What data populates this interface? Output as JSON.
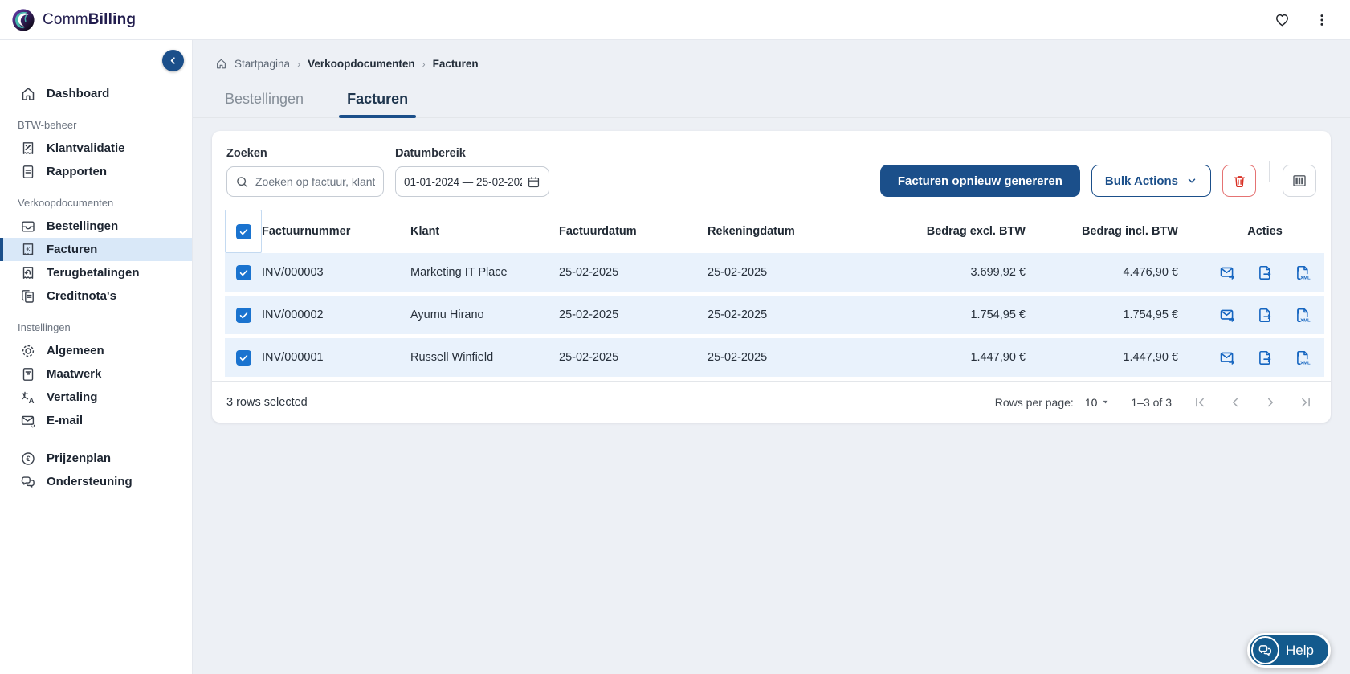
{
  "brand": {
    "prefix": "Comm",
    "suffix": "Billing"
  },
  "sidebar": {
    "items": [
      {
        "type": "item",
        "label": "Dashboard",
        "icon": "home-icon"
      },
      {
        "type": "section",
        "label": "BTW-beheer"
      },
      {
        "type": "item",
        "label": "Klantvalidatie",
        "icon": "receipt-percent-icon"
      },
      {
        "type": "item",
        "label": "Rapporten",
        "icon": "document-icon"
      },
      {
        "type": "section",
        "label": "Verkoopdocumenten"
      },
      {
        "type": "item",
        "label": "Bestellingen",
        "icon": "inbox-icon"
      },
      {
        "type": "item",
        "label": "Facturen",
        "icon": "receipt-euro-icon",
        "active": true
      },
      {
        "type": "item",
        "label": "Terugbetalingen",
        "icon": "receipt-return-icon"
      },
      {
        "type": "item",
        "label": "Creditnota's",
        "icon": "credit-notes-icon"
      },
      {
        "type": "section",
        "label": "Instellingen"
      },
      {
        "type": "item",
        "label": "Algemeen",
        "icon": "gear-icon"
      },
      {
        "type": "item",
        "label": "Maatwerk",
        "icon": "document-star-icon"
      },
      {
        "type": "item",
        "label": "Vertaling",
        "icon": "translate-icon"
      },
      {
        "type": "item",
        "label": "E-mail",
        "icon": "mail-gear-icon"
      },
      {
        "type": "item",
        "label": "Prijzenplan",
        "icon": "euro-circle-icon"
      },
      {
        "type": "item",
        "label": "Ondersteuning",
        "icon": "support-chat-icon"
      }
    ]
  },
  "breadcrumb": {
    "items": [
      "Startpagina",
      "Verkoopdocumenten",
      "Facturen"
    ]
  },
  "tabs": [
    {
      "label": "Bestellingen",
      "active": false
    },
    {
      "label": "Facturen",
      "active": true
    }
  ],
  "filters": {
    "search_label": "Zoeken",
    "search_placeholder": "Zoeken op factuur, klant,",
    "date_label": "Datumbereik",
    "date_value": "01-01-2024 — 25-02-202"
  },
  "toolbar": {
    "regenerate_label": "Facturen opnieuw genereren",
    "bulk_actions_label": "Bulk Actions",
    "icons": [
      "delete-trash-icon",
      "columns-icon"
    ]
  },
  "table": {
    "columns": [
      "Factuurnummer",
      "Klant",
      "Factuurdatum",
      "Rekeningdatum",
      "Bedrag excl. BTW",
      "Bedrag incl. BTW",
      "Acties"
    ],
    "row_action_icons": [
      "send-email-icon",
      "export-file-icon",
      "xml-file-icon"
    ],
    "rows": [
      {
        "selected": true,
        "invoice_number": "INV/000003",
        "client": "Marketing IT Place",
        "invoice_date": "25-02-2025",
        "billing_date": "25-02-2025",
        "amount_excl": "3.699,92 €",
        "amount_incl": "4.476,90 €"
      },
      {
        "selected": true,
        "invoice_number": "INV/000002",
        "client": "Ayumu Hirano",
        "invoice_date": "25-02-2025",
        "billing_date": "25-02-2025",
        "amount_excl": "1.754,95 €",
        "amount_incl": "1.754,95 €"
      },
      {
        "selected": true,
        "invoice_number": "INV/000001",
        "client": "Russell Winfield",
        "invoice_date": "25-02-2025",
        "billing_date": "25-02-2025",
        "amount_excl": "1.447,90 €",
        "amount_incl": "1.447,90 €"
      }
    ]
  },
  "footer": {
    "selected_text": "3 rows selected",
    "rows_per_page_label": "Rows per page:",
    "rows_per_page_value": "10",
    "range_text": "1–3 of 3"
  },
  "help": {
    "label": "Help"
  },
  "colors": {
    "accent": "#1b4f8a",
    "checkbox_blue": "#1a73cf",
    "selected_row_bg": "#e9f2fc",
    "active_nav_bg": "#d9e8f8",
    "danger": "#d93025",
    "action_icon_blue": "#1565c0"
  }
}
